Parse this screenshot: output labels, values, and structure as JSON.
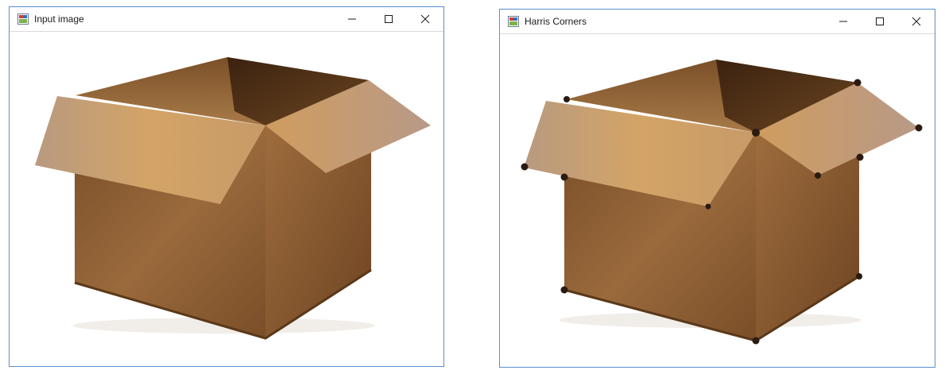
{
  "windows": [
    {
      "title": "Input image",
      "app_icon": "image-window-icon",
      "controls": [
        "minimize-icon",
        "maximize-icon",
        "close-icon"
      ],
      "content": "cardboard box image"
    },
    {
      "title": "Harris Corners",
      "app_icon": "image-window-icon",
      "controls": [
        "minimize-icon",
        "maximize-icon",
        "close-icon"
      ],
      "content": "cardboard box image with detected corner markers",
      "marker_color": "#2a1a10"
    }
  ],
  "colors": {
    "window_border": "#5b8fd0",
    "flap_light": "#d6a468",
    "box_side": "#8a5a30",
    "box_interior": "#4a2c14"
  }
}
